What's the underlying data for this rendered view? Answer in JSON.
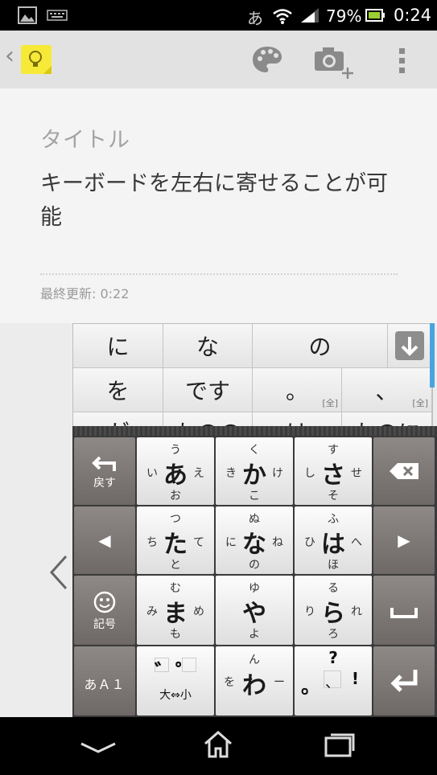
{
  "status_bar": {
    "ime": "あ",
    "battery": "79%",
    "time": "0:24"
  },
  "action_bar": {
    "back": "‹",
    "icons": [
      "keep-lightbulb-icon",
      "palette-icon",
      "camera-add-icon",
      "overflow-menu-icon"
    ]
  },
  "note": {
    "title_placeholder": "タイトル",
    "body": "キーボードを左右に寄せることが可能",
    "last_updated": "最終更新: 0:22"
  },
  "candidates": {
    "row1": [
      "に",
      "な",
      "の"
    ],
    "row2": [
      {
        "text": "を",
        "tag": ""
      },
      {
        "text": "です",
        "tag": ""
      },
      {
        "text": "。",
        "tag": "[全]"
      },
      {
        "text": "、",
        "tag": "[全]"
      }
    ],
    "row3_partial": [
      "が",
      "ものの",
      "は",
      "ものに"
    ]
  },
  "keyboard": {
    "undo_label": "戻す",
    "emoji_label": "記号",
    "mode_label": "あＡ１",
    "left_arrow": "◀",
    "right_arrow": "▶",
    "keys": [
      {
        "main": "あ",
        "top": "う",
        "left": "い",
        "right": "え",
        "bottom": "お"
      },
      {
        "main": "か",
        "top": "く",
        "left": "き",
        "right": "け",
        "bottom": "こ"
      },
      {
        "main": "さ",
        "top": "す",
        "left": "し",
        "right": "せ",
        "bottom": "そ"
      },
      {
        "main": "た",
        "top": "つ",
        "left": "ち",
        "right": "て",
        "bottom": "と"
      },
      {
        "main": "な",
        "top": "ぬ",
        "left": "に",
        "right": "ね",
        "bottom": "の"
      },
      {
        "main": "は",
        "top": "ふ",
        "left": "ひ",
        "right": "へ",
        "bottom": "ほ"
      },
      {
        "main": "ま",
        "top": "む",
        "left": "み",
        "right": "め",
        "bottom": "も"
      },
      {
        "main": "や",
        "top": "ゆ",
        "left": "",
        "right": "",
        "bottom": "よ"
      },
      {
        "main": "ら",
        "top": "る",
        "left": "り",
        "right": "れ",
        "bottom": "ろ"
      }
    ],
    "dakuten": {
      "marks": "゛゜",
      "sub": "大⇔小"
    },
    "wa": {
      "main": "わ",
      "top": "ん",
      "left": "を",
      "right": "ー"
    },
    "punct": {
      "top": "?",
      "left": "。",
      "mid": "、",
      "right": "!"
    }
  }
}
